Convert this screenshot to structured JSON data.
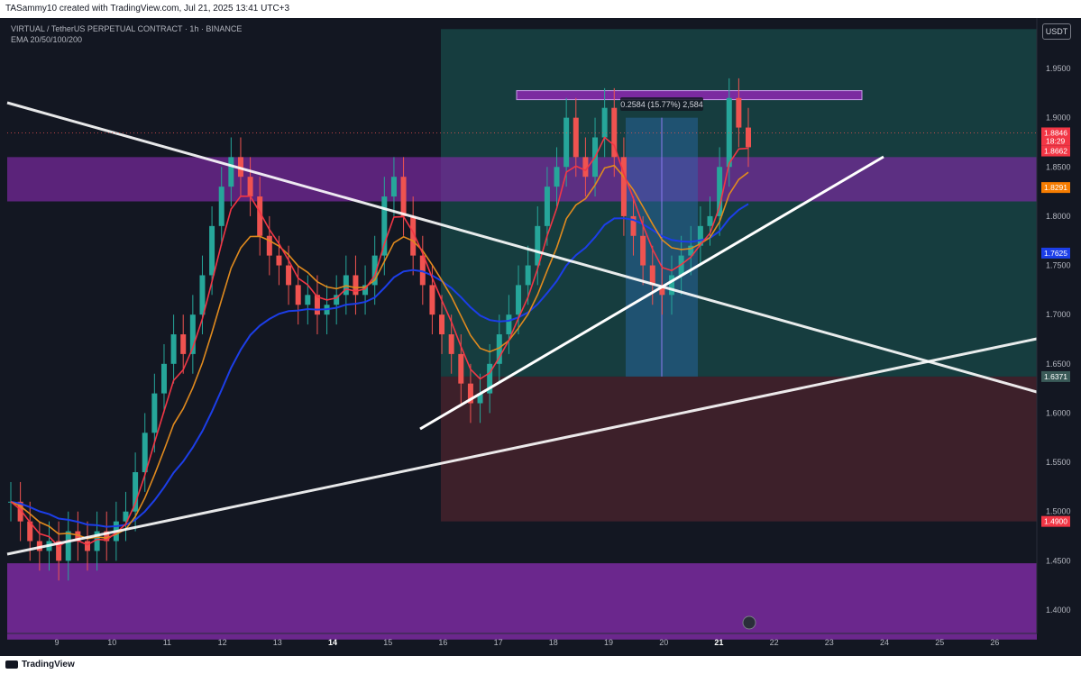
{
  "header": {
    "caption": "TASammy10 created with TradingView.com, Jul 21, 2025 13:41 UTC+3"
  },
  "legend": {
    "symbol": "VIRTUAL / TetherUS PERPETUAL CONTRACT · 1h · BINANCE",
    "indicator": "EMA 20/50/100/200"
  },
  "currency_button": "USDT",
  "footer": {
    "brand": "TradingView"
  },
  "colors": {
    "background": "#131722",
    "zone": "#7b2aa0",
    "target_zone": "#1a5c57",
    "stop_zone": "#5a2730",
    "candle_up": "#26a69a",
    "candle_down": "#ef5350",
    "ema20": "#f23645",
    "ema50": "#e08a1e",
    "ema100": "#1c3ee8",
    "line_white": "#ffffff"
  },
  "chart_data": {
    "type": "candlestick",
    "x_ticks": [
      "9",
      "10",
      "11",
      "12",
      "13",
      "14",
      "15",
      "16",
      "17",
      "18",
      "19",
      "20",
      "21",
      "22",
      "23",
      "24",
      "25",
      "26"
    ],
    "y_ticks": [
      "1.9500",
      "1.9000",
      "1.8500",
      "1.8000",
      "1.7500",
      "1.7000",
      "1.6500",
      "1.6000",
      "1.5500",
      "1.5000",
      "1.4500",
      "1.4000"
    ],
    "ylim": [
      1.37,
      1.99
    ],
    "price_labels": [
      {
        "text": "1.8846",
        "sub": "18:29",
        "value": 1.8846,
        "color": "#f23645"
      },
      {
        "text": "1.8662",
        "value": 1.8662,
        "color": "#f23645"
      },
      {
        "text": "1.8291",
        "value": 1.8291,
        "color": "#f57c00"
      },
      {
        "text": "1.7625",
        "value": 1.7625,
        "color": "#1c3ee8"
      },
      {
        "text": "1.6371",
        "value": 1.6371,
        "color": "#3a5a58"
      },
      {
        "text": "1.4900",
        "value": 1.49,
        "color": "#f23645"
      }
    ],
    "measure_label": "0.2584 (15.77%) 2,584",
    "candles_close": [
      1.51,
      1.49,
      1.47,
      1.46,
      1.47,
      1.45,
      1.48,
      1.47,
      1.46,
      1.48,
      1.47,
      1.49,
      1.5,
      1.54,
      1.58,
      1.62,
      1.65,
      1.68,
      1.66,
      1.7,
      1.74,
      1.79,
      1.83,
      1.86,
      1.84,
      1.82,
      1.78,
      1.76,
      1.75,
      1.73,
      1.71,
      1.72,
      1.7,
      1.71,
      1.72,
      1.74,
      1.72,
      1.73,
      1.76,
      1.82,
      1.84,
      1.8,
      1.76,
      1.73,
      1.7,
      1.68,
      1.66,
      1.63,
      1.61,
      1.62,
      1.65,
      1.68,
      1.7,
      1.73,
      1.75,
      1.79,
      1.83,
      1.85,
      1.9,
      1.86,
      1.84,
      1.88,
      1.91,
      1.86,
      1.8,
      1.78,
      1.75,
      1.73,
      1.72,
      1.74,
      1.76,
      1.77,
      1.79,
      1.8,
      1.85,
      1.92,
      1.89,
      1.87
    ]
  }
}
